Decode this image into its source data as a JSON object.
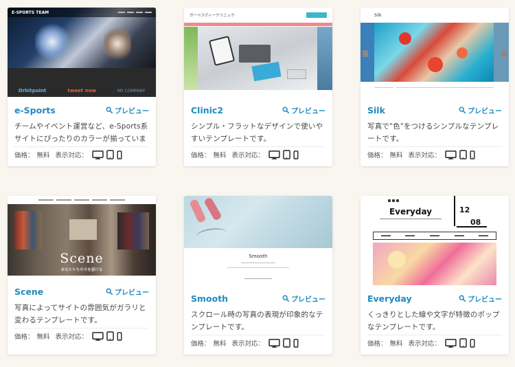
{
  "meta_labels": {
    "price_label": "価格：",
    "price_value": "無料",
    "support_label": "表示対応："
  },
  "preview_label": "プレビュー",
  "cards": [
    {
      "name": "e-Sports",
      "desc": "チームやイベント運営など、e-Sports系サイトにぴったりのカラーが揃っています。",
      "thumb": {
        "header": "E-SPORTS TEAM",
        "logos": [
          "Orbitpoint",
          "tweet now",
          "MY COMPANY"
        ]
      }
    },
    {
      "name": "Clinic2",
      "desc": "シンプル・フラットなデザインで使いやすいテンプレートです。",
      "thumb": {
        "header": "ガーベラディークリニック"
      }
    },
    {
      "name": "Silk",
      "desc": "写真で\"色\"をつけるシンプルなテンプレートです。",
      "thumb": {
        "header": "Silk"
      }
    },
    {
      "name": "Scene",
      "desc": "写真によってサイトの雰囲気がガラリと変わるテンプレートです。",
      "thumb": {
        "header": "Scene",
        "sub": "あなたたちの今を届ける"
      }
    },
    {
      "name": "Smooth",
      "desc": "スクロール時の写真の表現が印象的なテンプレートです。",
      "thumb": {
        "header": "Smooth"
      }
    },
    {
      "name": "Everyday",
      "desc": "くっきりとした線や文字が特徴のポップなテンプレートです。",
      "thumb": {
        "header": "Everyday",
        "date_top": "12",
        "date_bottom": "08"
      }
    }
  ],
  "colors": {
    "accent": "#1f8ac0",
    "background": "#f8f6ef"
  }
}
